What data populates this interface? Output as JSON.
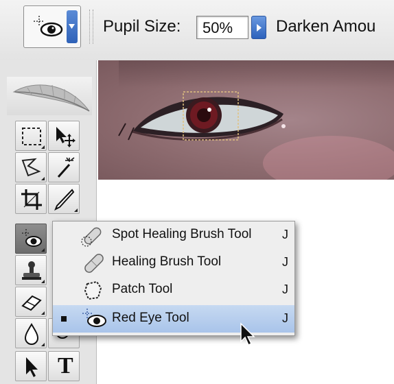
{
  "options_bar": {
    "pupil_size_label": "Pupil Size:",
    "pupil_size_value": "50%",
    "darken_label": "Darken Amou",
    "preset_icon": "red-eye-icon"
  },
  "toolbox": {
    "tools": [
      {
        "name": "rectangular-marquee-icon"
      },
      {
        "name": "move-icon"
      },
      {
        "name": "lasso-icon"
      },
      {
        "name": "magic-wand-icon"
      },
      {
        "name": "crop-icon"
      },
      {
        "name": "slice-icon"
      },
      {
        "name": "red-eye-icon",
        "active": true
      },
      {
        "name": "stamp-icon"
      },
      {
        "name": "eraser-icon"
      },
      {
        "name": "blur-drop-icon"
      },
      {
        "name": "path-selection-icon"
      },
      {
        "name": "type-icon"
      }
    ],
    "type_tool_glyph": "T"
  },
  "flyout_menu": {
    "items": [
      {
        "label": "Spot Healing Brush Tool",
        "shortcut": "J",
        "selected": false,
        "icon": "spot-healing-brush-icon"
      },
      {
        "label": "Healing Brush Tool",
        "shortcut": "J",
        "selected": false,
        "icon": "healing-brush-icon"
      },
      {
        "label": "Patch Tool",
        "shortcut": "J",
        "selected": false,
        "icon": "patch-icon"
      },
      {
        "label": "Red Eye Tool",
        "shortcut": "J",
        "selected": true,
        "icon": "red-eye-icon"
      }
    ]
  },
  "colors": {
    "accent_blue": "#2f62b8",
    "selected_row": "#b6cdee",
    "skin": "#8e6c70"
  }
}
